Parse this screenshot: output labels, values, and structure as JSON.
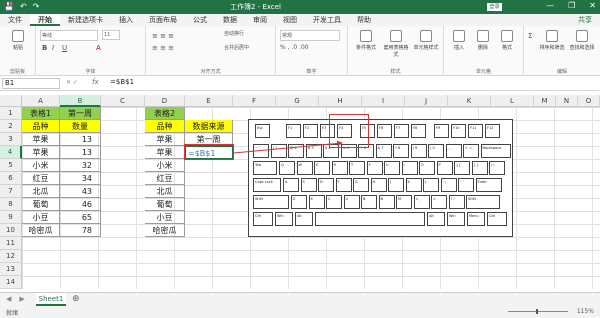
{
  "window": {
    "title": "工作簿2 - Excel",
    "login": "登录",
    "minimize": "—",
    "restore": "❐",
    "close": "✕"
  },
  "qat": {
    "save": "💾",
    "undo": "↶",
    "redo": "↷"
  },
  "tabs": [
    "文件",
    "开始",
    "新建选项卡",
    "插入",
    "页面布局",
    "公式",
    "数据",
    "审阅",
    "视图",
    "开发工具",
    "帮助"
  ],
  "share": "共享",
  "ribbon": {
    "clipboard": {
      "paste": "粘贴",
      "label": "剪贴板"
    },
    "font": {
      "name": "等线",
      "size": "11",
      "label": "字体"
    },
    "alignment": {
      "wrap": "自动换行",
      "merge": "合并后居中",
      "label": "对齐方式"
    },
    "number": {
      "format": "常规",
      "label": "数字"
    },
    "styles": {
      "conditional": "条件格式",
      "table": "套用表格格式",
      "cell": "单元格样式",
      "label": "样式"
    },
    "cells": {
      "insert": "插入",
      "delete": "删除",
      "format": "格式",
      "label": "单元格"
    },
    "editing": {
      "sort": "排序和筛选",
      "find": "查找和选择",
      "label": "编辑"
    }
  },
  "formula": {
    "namebox": "B1",
    "fx": "fx",
    "content": "=$B$1"
  },
  "columns": [
    "A",
    "B",
    "C",
    "D",
    "E",
    "F",
    "G",
    "H",
    "I",
    "J",
    "K",
    "L",
    "M",
    "N",
    "O"
  ],
  "rows": [
    "1",
    "2",
    "3",
    "4",
    "5",
    "6",
    "7",
    "8",
    "9",
    "10",
    "11",
    "12",
    "13",
    "14"
  ],
  "table1": {
    "title": "表格1",
    "title2": "第一周",
    "headers": [
      "品种",
      "数量"
    ],
    "rows": [
      [
        "苹果",
        "13"
      ],
      [
        "苹果",
        "13"
      ],
      [
        "小米",
        "32"
      ],
      [
        "红豆",
        "34"
      ],
      [
        "北瓜",
        "43"
      ],
      [
        "葡萄",
        "46"
      ],
      [
        "小豆",
        "65"
      ],
      [
        "哈密瓜",
        "78"
      ]
    ]
  },
  "table2": {
    "title": "表格2",
    "headers": [
      "品种",
      "数据来源"
    ],
    "e3": "第一周",
    "e4": "=$B$1",
    "items": [
      "苹果",
      "苹果",
      "小米",
      "红豆",
      "北瓜",
      "葡萄",
      "小豆",
      "哈密瓜"
    ]
  },
  "keyboard": {
    "row0": [
      "Esc",
      "F1",
      "F2",
      "F3",
      "F4",
      "F5",
      "F6",
      "F7",
      "F8",
      "F9",
      "F10",
      "F11",
      "F12"
    ],
    "row1": [
      "~ `",
      "! 1",
      "@ 2",
      "# 3",
      "$ 4",
      "% 5",
      "^ 6",
      "& 7",
      "* 8",
      "( 9",
      ") 0",
      "_ -",
      "+ =",
      "Backspace"
    ],
    "row2": [
      "Tab",
      "Q",
      "W",
      "E",
      "R",
      "T",
      "Y",
      "U",
      "I",
      "O",
      "P",
      "{ [",
      "} ]",
      "| \\"
    ],
    "row3": [
      "Caps Lock",
      "A",
      "S",
      "D",
      "F",
      "G",
      "H",
      "J",
      "K",
      "L",
      ": ;",
      "\" '",
      "Enter"
    ],
    "row4": [
      "Shift",
      "Z",
      "X",
      "C",
      "V",
      "B",
      "N",
      "M",
      "< ,",
      "> .",
      "? /",
      "Shift"
    ],
    "row5": [
      "Ctrl",
      "Win",
      "Alt",
      "",
      "Alt",
      "Win",
      "Menu",
      "Ctrl"
    ]
  },
  "sheet": {
    "name": "Sheet1",
    "add": "⊕"
  },
  "status": {
    "ready": "就绪",
    "zoom": "115%"
  }
}
